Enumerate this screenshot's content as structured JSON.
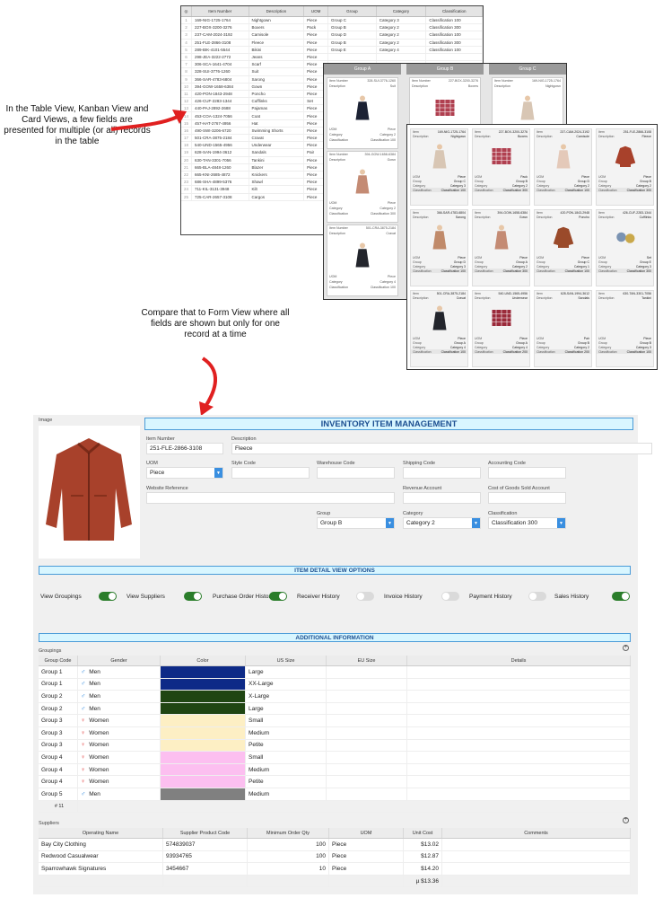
{
  "callouts": {
    "top": "In the Table View, Kanban View and Card Views, a few fields are presented for multiple (or all) records in the table",
    "middle": "Compare that to Form View where all fields are shown but only for one record at a time"
  },
  "table_view": {
    "headers": [
      "Item Number",
      "Description",
      "UOM",
      "Group",
      "Category",
      "Classification"
    ],
    "rows": [
      [
        "169-NIG-1725-1764",
        "Nightgown",
        "Piece",
        "Group C",
        "Category 3",
        "Classification 100"
      ],
      [
        "227-BOX-3200-3276",
        "Boxers",
        "Pack",
        "Group B",
        "Category 2",
        "Classification 300"
      ],
      [
        "237-CAM-2024-3192",
        "Camisole",
        "Piece",
        "Group D",
        "Category 2",
        "Classification 100"
      ],
      [
        "251-FLE-2866-3108",
        "Fleece",
        "Piece",
        "Group B",
        "Category 2",
        "Classification 300"
      ],
      [
        "289-BIK-4101-5544",
        "Bikini",
        "Piece",
        "Group E",
        "Category 4",
        "Classification 100"
      ],
      [
        "298-JEA-3222-2772",
        "Jeans",
        "Piece",
        "",
        "",
        ""
      ],
      [
        "306-SCA-1641-4704",
        "Scarf",
        "Piece",
        "",
        "",
        ""
      ],
      [
        "328-SUI-3776-1260",
        "Suit",
        "Piece",
        "",
        "",
        ""
      ],
      [
        "366-SAR-4783-6804",
        "Sarong",
        "Piece",
        "",
        "",
        ""
      ],
      [
        "394-GOW-1658-6384",
        "Gown",
        "Piece",
        "",
        "",
        ""
      ],
      [
        "420-PON-1843-2948",
        "Poncho",
        "Piece",
        "",
        "",
        ""
      ],
      [
        "426-CUF-2283-1344",
        "Cufflinks",
        "Set",
        "",
        "",
        ""
      ],
      [
        "440-PAJ-2892-2688",
        "Pajamas",
        "Piece",
        "",
        "",
        ""
      ],
      [
        "453-COA-1324-7056",
        "Coat",
        "Piece",
        "",
        "",
        ""
      ],
      [
        "457-HAT-2767-4956",
        "Hat",
        "Piece",
        "",
        "",
        ""
      ],
      [
        "490-SWI-3206-6720",
        "Swimming Shorts",
        "Piece",
        "",
        "",
        ""
      ],
      [
        "501-CRA-3875-2184",
        "Cravat",
        "Piece",
        "",
        "",
        ""
      ],
      [
        "540-UND-1565-4956",
        "Underwear",
        "Piece",
        "",
        "",
        ""
      ],
      [
        "628-SAN-1994-3612",
        "Sandals",
        "Pair",
        "",
        "",
        ""
      ],
      [
        "630-TAN-3301-7056",
        "Tankini",
        "Piece",
        "",
        "",
        ""
      ],
      [
        "665-BLA-4848-1260",
        "Blazer",
        "Piece",
        "",
        "",
        ""
      ],
      [
        "665-KNI-2685-4872",
        "Knickers",
        "Piece",
        "",
        "",
        ""
      ],
      [
        "686-SHA-4899-5376",
        "Shawl",
        "Piece",
        "",
        "",
        ""
      ],
      [
        "711-KIL-3131-3948",
        "Kilt",
        "Piece",
        "",
        "",
        ""
      ],
      [
        "725-CAR-2657-3108",
        "Cargos",
        "Piece",
        "",
        "",
        ""
      ]
    ]
  },
  "kanban_view": {
    "columns": [
      "Group A",
      "Group B",
      "Group C"
    ],
    "field_labels": {
      "item_number": "Item Number",
      "description": "Description",
      "uom": "UOM",
      "category": "Category",
      "classification": "Classification"
    },
    "cards": [
      {
        "col": 0,
        "item": "328-SUI-3776-1260",
        "desc": "Suit",
        "uom": "Piece",
        "cat": "Category 2",
        "cls": "Classification 100"
      },
      {
        "col": 0,
        "item": "394-GOW-1658-6384",
        "desc": "Gown",
        "uom": "Piece",
        "cat": "Category 2",
        "cls": "Classification 300"
      },
      {
        "col": 0,
        "item": "501-CRA-3875-2184",
        "desc": "Cravat",
        "uom": "Piece",
        "cat": "Category 4",
        "cls": "Classification 100"
      },
      {
        "col": 1,
        "item": "227-BOX-3200-3276",
        "desc": "Boxers",
        "uom": "",
        "cat": "",
        "cls": ""
      },
      {
        "col": 2,
        "item": "169-NIG-1725-1764",
        "desc": "Nightgown",
        "uom": "",
        "cat": "",
        "cls": ""
      }
    ]
  },
  "card_view": {
    "field_labels": {
      "item": "Item",
      "description": "Description",
      "uom": "UOM",
      "group": "Group",
      "category": "Category",
      "classification": "Classification"
    },
    "cards": [
      {
        "item": "169-NIG-1725-1764",
        "desc": "Nightgown",
        "uom": "Piece",
        "group": "Group C",
        "cat": "Category 3",
        "cls": "Classification 100"
      },
      {
        "item": "227-BOX-3200-3276",
        "desc": "Boxers",
        "uom": "Pack",
        "group": "Group B",
        "cat": "Category 2",
        "cls": "Classification 300"
      },
      {
        "item": "237-CAM-2024-3192",
        "desc": "Camisole",
        "uom": "Piece",
        "group": "Group D",
        "cat": "Category 2",
        "cls": "Classification 100"
      },
      {
        "item": "251-FLE-2866-3108",
        "desc": "Fleece",
        "uom": "Piece",
        "group": "Group B",
        "cat": "Category 2",
        "cls": "Classification 300"
      },
      {
        "item": "366-SAR-4783-6804",
        "desc": "Sarong",
        "uom": "Piece",
        "group": "Group D",
        "cat": "Category 3",
        "cls": "Classification 100"
      },
      {
        "item": "394-GOW-1658-6384",
        "desc": "Gown",
        "uom": "Piece",
        "group": "Group A",
        "cat": "Category 2",
        "cls": "Classification 300"
      },
      {
        "item": "420-PON-1843-2948",
        "desc": "Poncho",
        "uom": "Piece",
        "group": "Group C",
        "cat": "Category 1",
        "cls": "Classification 100"
      },
      {
        "item": "426-CUF-2283-1344",
        "desc": "Cufflinks",
        "uom": "Set",
        "group": "Group E",
        "cat": "Category 3",
        "cls": "Classification 300"
      },
      {
        "item": "501-CRA-3875-2184",
        "desc": "Cravat",
        "uom": "Piece",
        "group": "Group A",
        "cat": "Category 4",
        "cls": "Classification 100"
      },
      {
        "item": "540-UND-1565-4956",
        "desc": "Underwear",
        "uom": "Piece",
        "group": "Group A",
        "cat": "Category 4",
        "cls": "Classification 200"
      },
      {
        "item": "628-SAN-1994-3612",
        "desc": "Sandals",
        "uom": "Pair",
        "group": "Group B",
        "cat": "Category 2",
        "cls": "Classification 200"
      },
      {
        "item": "630-TAN-3301-7056",
        "desc": "Tankini",
        "uom": "Piece",
        "group": "Group B",
        "cat": "Category 3",
        "cls": "Classification 100"
      }
    ]
  },
  "form": {
    "image_label": "Image",
    "title": "INVENTORY ITEM MANAGEMENT",
    "fields": {
      "item_number": {
        "label": "Item Number",
        "value": "251-FLE-2866-3108"
      },
      "description": {
        "label": "Description",
        "value": "Fleece"
      },
      "uom": {
        "label": "UOM",
        "value": "Piece"
      },
      "style_code": {
        "label": "Style Code",
        "value": ""
      },
      "warehouse_code": {
        "label": "Warehouse Code",
        "value": ""
      },
      "shipping_code": {
        "label": "Shipping Code",
        "value": ""
      },
      "accounting_code": {
        "label": "Accounting Code",
        "value": ""
      },
      "website_reference": {
        "label": "Website Reference",
        "value": ""
      },
      "revenue_account": {
        "label": "Revenue Account",
        "value": ""
      },
      "cogs_account": {
        "label": "Cost of Goods Sold Account",
        "value": ""
      },
      "group": {
        "label": "Group",
        "value": "Group B"
      },
      "category": {
        "label": "Category",
        "value": "Category 2"
      },
      "classification": {
        "label": "Classification",
        "value": "Classification 300"
      }
    },
    "detail_options_title": "ITEM DETAIL VIEW OPTIONS",
    "toggles": [
      {
        "label": "View Groupings",
        "on": true
      },
      {
        "label": "View Suppliers",
        "on": true
      },
      {
        "label": "Purchase Order History",
        "on": true
      },
      {
        "label": "Receiver History",
        "on": false
      },
      {
        "label": "Invoice History",
        "on": false
      },
      {
        "label": "Payment History",
        "on": false
      },
      {
        "label": "Sales History",
        "on": true
      }
    ],
    "additional_title": "ADDITIONAL INFORMATION",
    "groupings": {
      "label": "Groupings",
      "headers": [
        "Group Code",
        "Gender",
        "Color",
        "US Size",
        "EU Size",
        "Details"
      ],
      "rows": [
        {
          "group": "Group 1",
          "gender": "Men",
          "color": "#0d2a87",
          "us": "Large"
        },
        {
          "group": "Group 1",
          "gender": "Men",
          "color": "#0d2a87",
          "us": "XX-Large"
        },
        {
          "group": "Group 2",
          "gender": "Men",
          "color": "#1f4512",
          "us": "X-Large"
        },
        {
          "group": "Group 2",
          "gender": "Men",
          "color": "#1f4512",
          "us": "Large"
        },
        {
          "group": "Group 3",
          "gender": "Women",
          "color": "#fdefc4",
          "us": "Small"
        },
        {
          "group": "Group 3",
          "gender": "Women",
          "color": "#fdefc4",
          "us": "Medium"
        },
        {
          "group": "Group 3",
          "gender": "Women",
          "color": "#fdefc4",
          "us": "Petite"
        },
        {
          "group": "Group 4",
          "gender": "Women",
          "color": "#fcbff0",
          "us": "Small"
        },
        {
          "group": "Group 4",
          "gender": "Women",
          "color": "#fcbff0",
          "us": "Medium"
        },
        {
          "group": "Group 4",
          "gender": "Women",
          "color": "#fcbff0",
          "us": "Petite"
        },
        {
          "group": "Group 5",
          "gender": "Men",
          "color": "#808080",
          "us": "Medium"
        }
      ],
      "count": "# 11"
    },
    "suppliers": {
      "label": "Suppliers",
      "headers": [
        "Operating Name",
        "Supplier Product Code",
        "Minimum Order Qty",
        "UOM",
        "Unit Cost",
        "Comments"
      ],
      "rows": [
        {
          "name": "Bay City Clothing",
          "code": "574839037",
          "qty": "100",
          "uom": "Piece",
          "cost": "$13.02"
        },
        {
          "name": "Redwood Casualwear",
          "code": "93934765",
          "qty": "100",
          "uom": "Piece",
          "cost": "$12.87"
        },
        {
          "name": "Sparrowhawk Signatures",
          "code": "3454667",
          "qty": "10",
          "uom": "Piece",
          "cost": "$14.20"
        }
      ],
      "avg": "µ $13.36"
    }
  }
}
